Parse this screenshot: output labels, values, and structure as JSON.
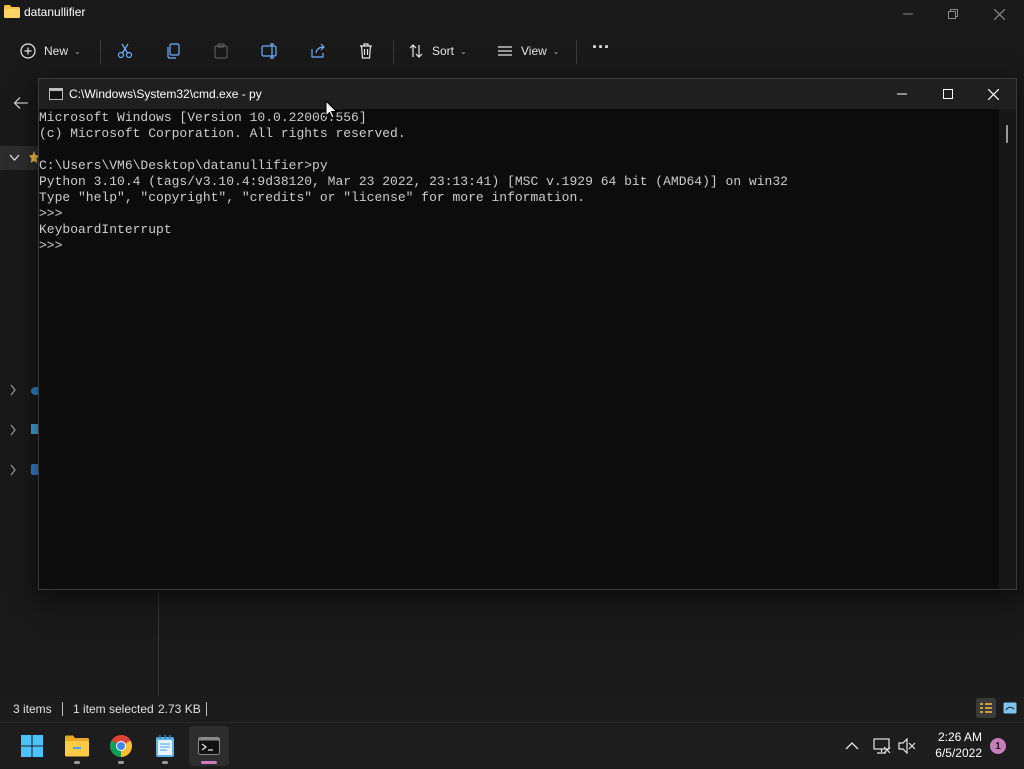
{
  "explorer": {
    "title": "datanullifier",
    "toolbar": {
      "new_label": "New",
      "sort_label": "Sort",
      "view_label": "View",
      "more_label": "···"
    },
    "status": {
      "items_count": "3 items",
      "selection": "1 item selected",
      "size": "2.73 KB"
    }
  },
  "cmd": {
    "title": "C:\\Windows\\System32\\cmd.exe - py",
    "lines": [
      "Microsoft Windows [Version 10.0.22000.556]",
      "(c) Microsoft Corporation. All rights reserved.",
      "",
      "C:\\Users\\VM6\\Desktop\\datanullifier>py",
      "Python 3.10.4 (tags/v3.10.4:9d38120, Mar 23 2022, 23:13:41) [MSC v.1929 64 bit (AMD64)] on win32",
      "Type \"help\", \"copyright\", \"credits\" or \"license\" for more information.",
      ">>>",
      "KeyboardInterrupt",
      ">>>"
    ]
  },
  "taskbar": {
    "apps": [
      "start",
      "file-explorer",
      "chrome",
      "notepad",
      "terminal"
    ],
    "clock": {
      "time": "2:26 AM",
      "date": "6/5/2022"
    },
    "notification_count": "1"
  },
  "colors": {
    "accent": "#c77dba",
    "console_text": "#cccccc",
    "console_bg": "#0c0c0c",
    "folder": "#f5c044"
  }
}
